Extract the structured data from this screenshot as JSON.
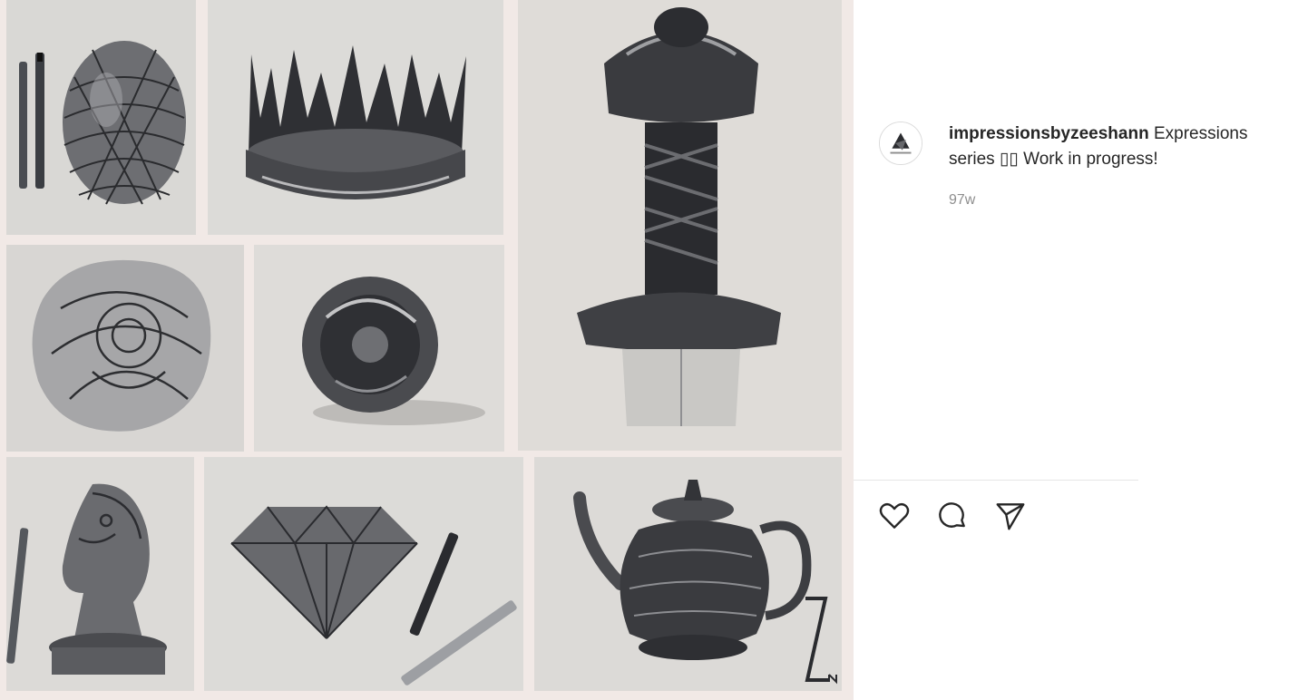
{
  "post": {
    "username": "impressionsbyzeeshann",
    "caption": "Expressions series ▯▯ Work in progress!",
    "timestamp": "97w",
    "watermark": "ZN"
  },
  "colors": {
    "tile_bg": "#dcdad6",
    "collage_border": "#f1e9e6",
    "ink": "#2b2b2e",
    "muted": "#8e8e8e"
  },
  "icons": {
    "like": "heart-icon",
    "comment": "comment-icon",
    "share": "paper-plane-icon"
  }
}
